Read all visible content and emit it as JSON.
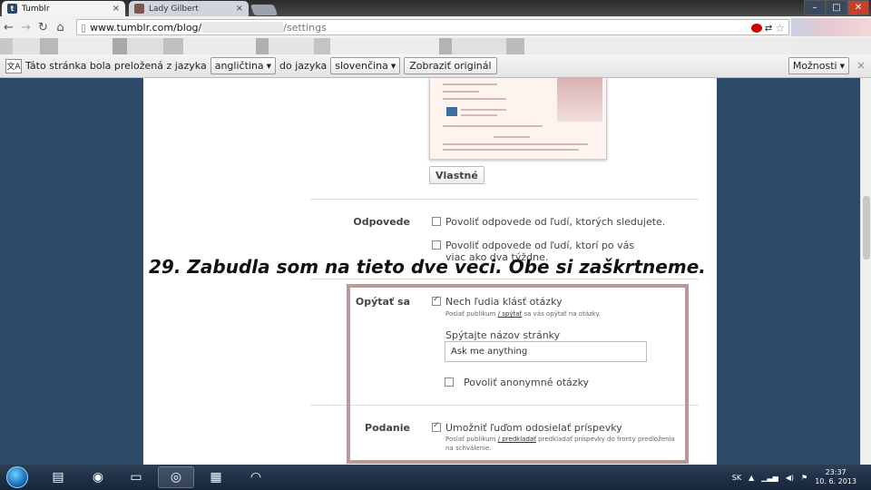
{
  "tabs": [
    {
      "title": "Tumblr",
      "favicon": "t",
      "close": "×"
    },
    {
      "title": "Lady Gilbert",
      "close": "×"
    }
  ],
  "address": {
    "host": "www.tumblr.com/blog/",
    "path": "/settings"
  },
  "translate_bar": {
    "message": "Táto stránka bola preložená z jazyka",
    "from_lang": "angličtina",
    "to_word": "do jazyka",
    "to_lang": "slovenčina",
    "show_original": "Zobraziť originál",
    "options": "Možnosti",
    "close": "×"
  },
  "theme": {
    "custom_button": "Vlastné"
  },
  "replies": {
    "label": "Odpovede",
    "option1": "Povoliť odpovede od ľudí, ktorých sledujete.",
    "option2": "Povoliť odpovede od ľudí, ktorí po vás viac ako dva týždne."
  },
  "overlay_caption": "29. Zabudla som na tieto dve veci. Obe si zaškrtneme.",
  "ask": {
    "label": "Opýtať sa",
    "option": "Nech ľudia klásť otázky",
    "sub_prefix": "Poslať publikum",
    "sub_link": "/ spýtať",
    "sub_suffix": "sa vás opýtať na otázky.",
    "page_title_label": "Spýtajte názov stránky",
    "page_title_value": "Ask me anything",
    "anon": "Povoliť anonymné otázky"
  },
  "submit": {
    "label": "Podanie",
    "option": "Umožniť ľuďom odosielať príspevky",
    "sub_prefix": "Poslať publikum",
    "sub_link": "/ predkladať",
    "sub_suffix": "predkladať príspevky do fronty predloženia na schválenie."
  },
  "taskbar": {
    "lang": "SK",
    "time": "23:37",
    "date": "10. 6. 2013"
  },
  "colors": {
    "frame": "#b89a9a",
    "desktop": "#2d4a6a"
  }
}
